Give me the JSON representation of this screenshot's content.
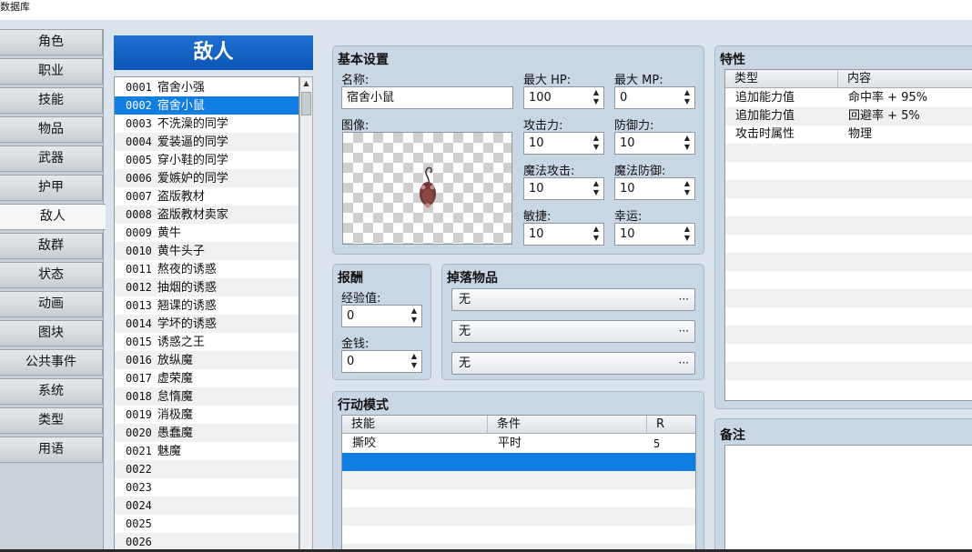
{
  "window": {
    "title": "数据库"
  },
  "tabs": [
    "角色",
    "职业",
    "技能",
    "物品",
    "武器",
    "护甲",
    "敌人",
    "敌群",
    "状态",
    "动画",
    "图块",
    "公共事件",
    "系统",
    "类型",
    "用语"
  ],
  "active_tab": "敌人",
  "enemy_list": {
    "header": "敌人",
    "selected_index": 1,
    "items": [
      {
        "id": "0001",
        "name": "宿舍小强"
      },
      {
        "id": "0002",
        "name": "宿舍小鼠"
      },
      {
        "id": "0003",
        "name": "不洗澡的同学"
      },
      {
        "id": "0004",
        "name": "爱装逼的同学"
      },
      {
        "id": "0005",
        "name": "穿小鞋的同学"
      },
      {
        "id": "0006",
        "name": "爱嫉妒的同学"
      },
      {
        "id": "0007",
        "name": "盗版教材"
      },
      {
        "id": "0008",
        "name": "盗版教材卖家"
      },
      {
        "id": "0009",
        "name": "黄牛"
      },
      {
        "id": "0010",
        "name": "黄牛头子"
      },
      {
        "id": "0011",
        "name": "熬夜的诱惑"
      },
      {
        "id": "0012",
        "name": "抽烟的诱惑"
      },
      {
        "id": "0013",
        "name": "翘课的诱惑"
      },
      {
        "id": "0014",
        "name": "学坏的诱惑"
      },
      {
        "id": "0015",
        "name": "诱惑之王"
      },
      {
        "id": "0016",
        "name": "放纵魔"
      },
      {
        "id": "0017",
        "name": "虚荣魔"
      },
      {
        "id": "0018",
        "name": "怠惰魔"
      },
      {
        "id": "0019",
        "name": "消极魔"
      },
      {
        "id": "0020",
        "name": "愚蠢魔"
      },
      {
        "id": "0021",
        "name": "魅魔"
      },
      {
        "id": "0022",
        "name": ""
      },
      {
        "id": "0023",
        "name": ""
      },
      {
        "id": "0024",
        "name": ""
      },
      {
        "id": "0025",
        "name": ""
      },
      {
        "id": "0026",
        "name": ""
      }
    ]
  },
  "basic": {
    "title": "基本设置",
    "name_label": "名称:",
    "name_value": "宿舍小鼠",
    "image_label": "图像:",
    "mhp_label": "最大 HP:",
    "mhp": "100",
    "mmp_label": "最大 MP:",
    "mmp": "0",
    "atk_label": "攻击力:",
    "atk": "10",
    "def_label": "防御力:",
    "def": "10",
    "mat_label": "魔法攻击:",
    "mat": "10",
    "mdf_label": "魔法防御:",
    "mdf": "10",
    "agi_label": "敏捷:",
    "agi": "10",
    "luk_label": "幸运:",
    "luk": "10",
    "spin_up": "▲",
    "spin_down": "▼"
  },
  "rewards": {
    "title": "报酬",
    "exp_label": "经验值:",
    "exp": "0",
    "gold_label": "金钱:",
    "gold": "0"
  },
  "drops": {
    "title": "掉落物品",
    "items": [
      "无",
      "无",
      "无"
    ],
    "more": "···"
  },
  "actions": {
    "title": "行动模式",
    "headers": [
      "技能",
      "条件",
      "R"
    ],
    "rows": [
      {
        "skill": "撕咬",
        "condition": "平时",
        "rating": "5"
      }
    ]
  },
  "traits": {
    "title": "特性",
    "headers": [
      "类型",
      "内容"
    ],
    "rows": [
      {
        "type": "追加能力值",
        "content": "命中率 + 95%"
      },
      {
        "type": "追加能力值",
        "content": "回避率 + 5%"
      },
      {
        "type": "攻击时属性",
        "content": "物理"
      }
    ]
  },
  "notes": {
    "title": "备注",
    "text": ""
  },
  "colors": {
    "list_header": "#0b56b6",
    "selection": "#0f7de1",
    "panel": "#c9d6e4"
  }
}
